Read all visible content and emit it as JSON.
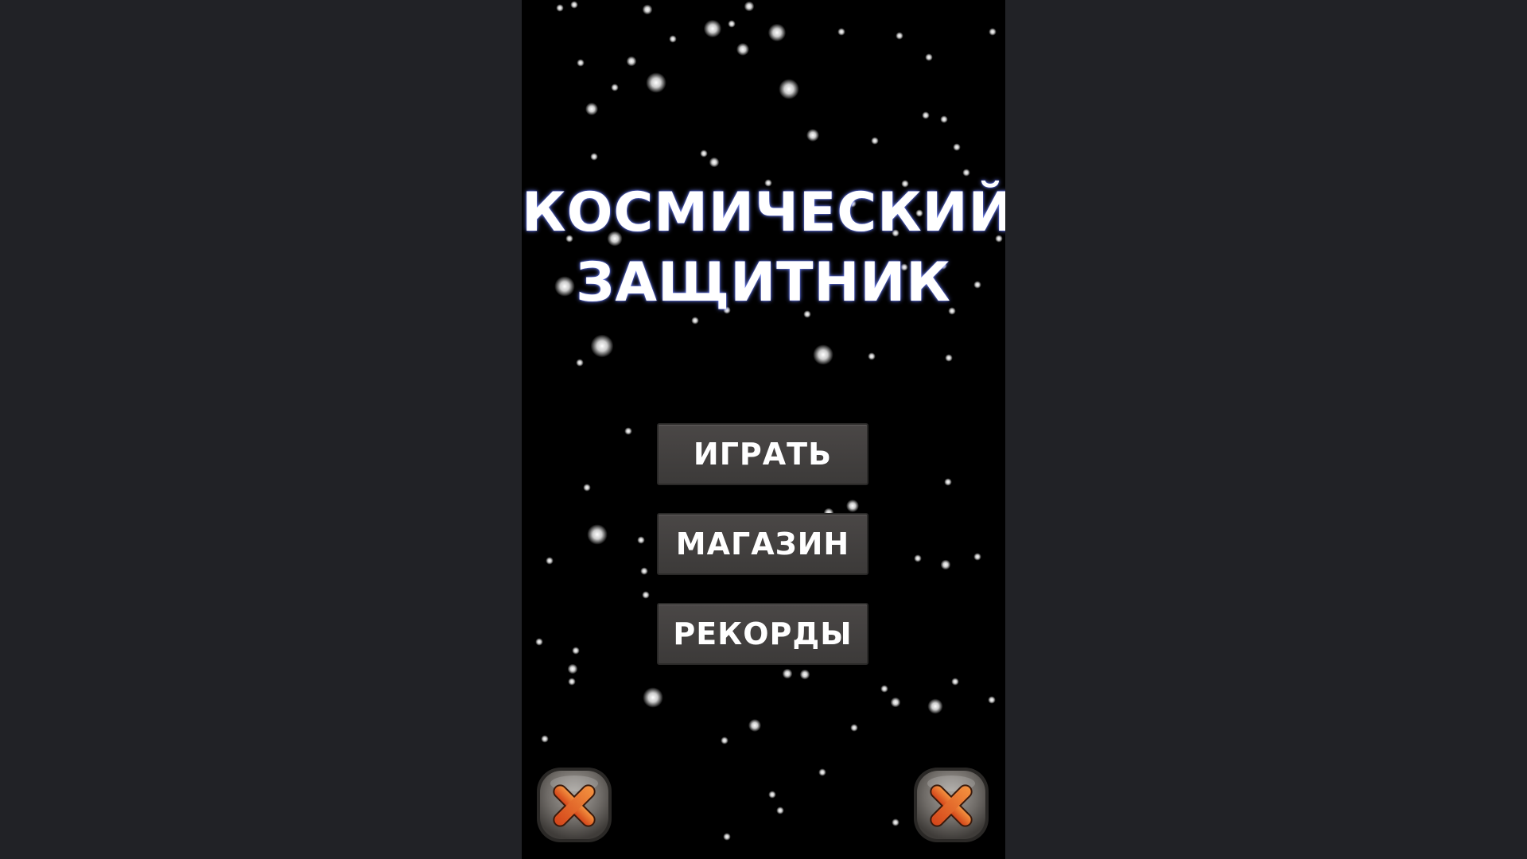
{
  "title": {
    "line1": "КОСМИЧЕСКИЙ",
    "line2": "ЗАЩИТНИК"
  },
  "menu": {
    "play_label": "ИГРАТЬ",
    "shop_label": "МАГАЗИН",
    "records_label": "РЕКОРДЫ"
  },
  "corner_buttons": {
    "left_icon": "close-icon",
    "right_icon": "close-icon"
  },
  "colors": {
    "page_background": "#212226",
    "game_background": "#000000",
    "button_face": "#43413f",
    "title_glow": "#7a8cff",
    "close_cross": "#e8661c"
  }
}
